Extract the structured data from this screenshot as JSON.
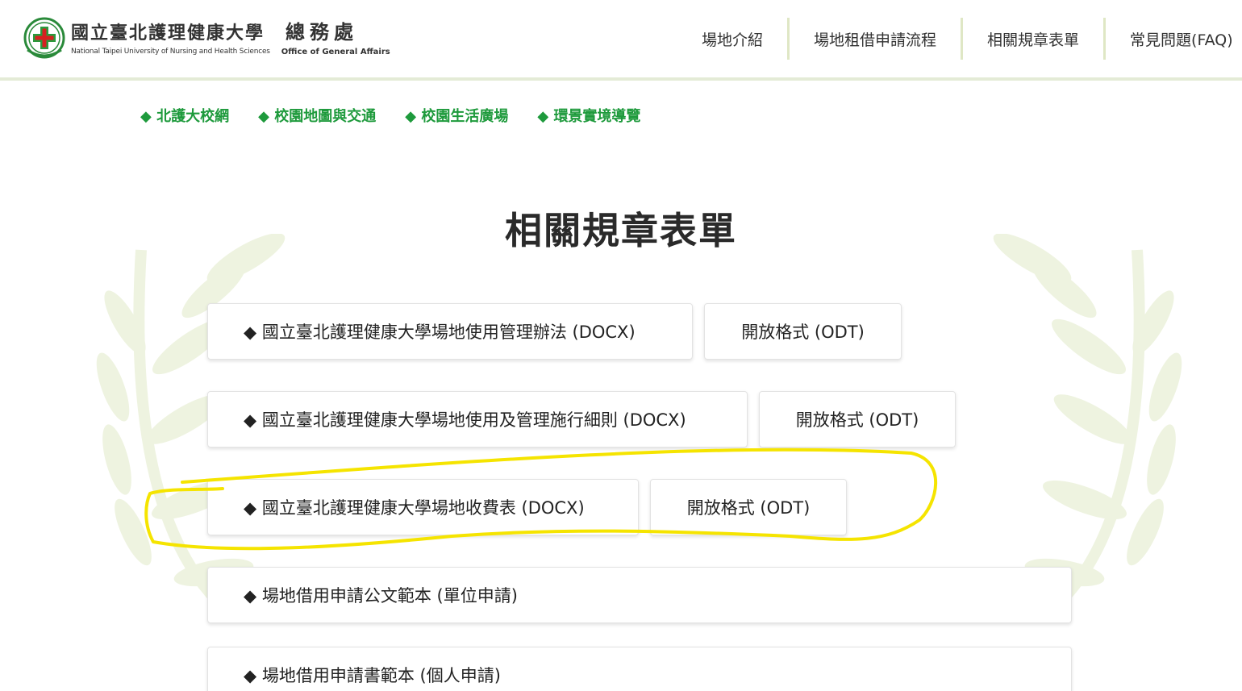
{
  "header": {
    "university_zh": "國立臺北護理健康大學",
    "office_zh": "總務處",
    "university_en": "National Taipei University of Nursing and Health Sciences",
    "office_en": "Office of General Affairs",
    "emblem_icon": "university-emblem-icon",
    "nav": [
      {
        "label": "場地介紹"
      },
      {
        "label": "場地租借申請流程"
      },
      {
        "label": "相關規章表單"
      },
      {
        "label": "常見問題(FAQ)"
      }
    ]
  },
  "quick_links": [
    {
      "label": "◆ 北護大校網"
    },
    {
      "label": "◆ 校園地圖與交通"
    },
    {
      "label": "◆ 校園生活廣場"
    },
    {
      "label": "◆ 環景實境導覽"
    }
  ],
  "page_title": "相關規章表單",
  "documents": [
    {
      "label": "◆ 國立臺北護理健康大學場地使用管理辦法 (DOCX)",
      "odt_label": "開放格式 (ODT)"
    },
    {
      "label": "◆ 國立臺北護理健康大學場地使用及管理施行細則 (DOCX)",
      "odt_label": "開放格式 (ODT)"
    },
    {
      "label": "◆ 國立臺北護理健康大學場地收費表 (DOCX)",
      "odt_label": "開放格式 (ODT)"
    },
    {
      "label": "◆ 場地借用申請公文範本 (單位申請)"
    },
    {
      "label": "◆ 場地借用申請書範本 (個人申請)"
    }
  ],
  "colors": {
    "accent_green": "#1e9a3c",
    "header_border": "#e4ebd6",
    "laurel": "#eef3e0",
    "highlight_yellow": "#f5e400"
  }
}
